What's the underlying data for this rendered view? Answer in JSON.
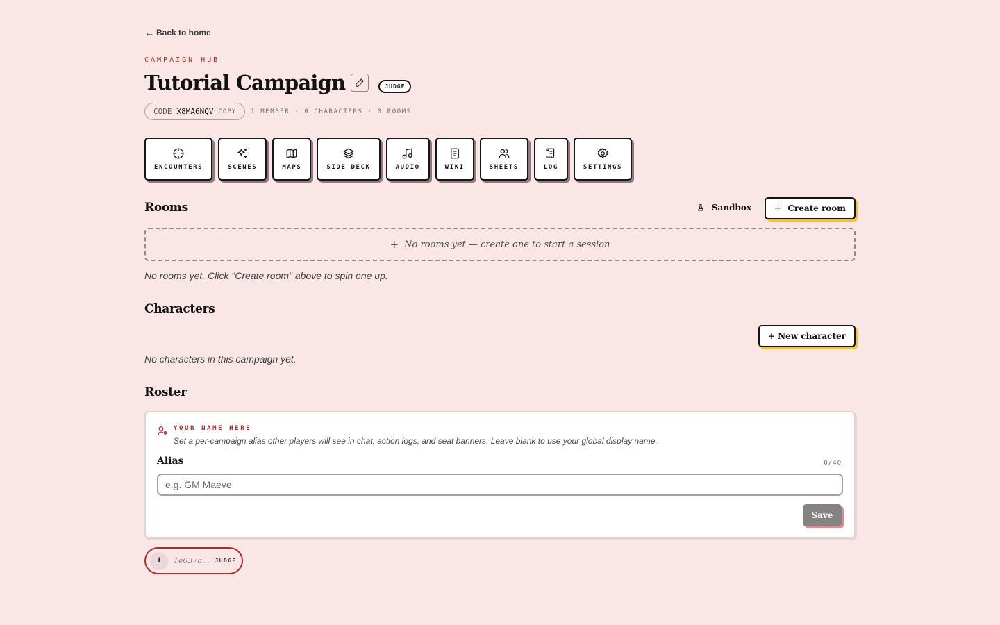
{
  "nav": {
    "back_arrow": "←",
    "back_label": "Back to home"
  },
  "header": {
    "eyebrow": "CAMPAIGN HUB",
    "title": "Tutorial Campaign",
    "role_badge": "JUDGE",
    "code_label": "CODE",
    "code_value": "X8MA6NQV",
    "copy_label": "COPY",
    "stats": "1 MEMBER · 0 CHARACTERS · 0 ROOMS"
  },
  "tools": [
    {
      "label": "ENCOUNTERS",
      "icon": "crosshair-icon"
    },
    {
      "label": "SCENES",
      "icon": "sparkles-icon"
    },
    {
      "label": "MAPS",
      "icon": "map-icon"
    },
    {
      "label": "SIDE DECK",
      "icon": "layers-icon"
    },
    {
      "label": "AUDIO",
      "icon": "music-icon"
    },
    {
      "label": "WIKI",
      "icon": "book-icon"
    },
    {
      "label": "SHEETS",
      "icon": "users-icon"
    },
    {
      "label": "LOG",
      "icon": "scroll-icon"
    },
    {
      "label": "SETTINGS",
      "icon": "gear-icon"
    }
  ],
  "rooms": {
    "title": "Rooms",
    "sandbox_label": "Sandbox",
    "create_icon": "+",
    "create_label": "Create room",
    "empty_icon": "+",
    "empty_label": "No rooms yet — create one to start a session",
    "note": "No rooms yet. Click \"Create room\" above to spin one up."
  },
  "characters": {
    "title": "Characters",
    "new_label": "+ New character",
    "note": "No characters in this campaign yet."
  },
  "roster": {
    "title": "Roster",
    "alias_card": {
      "eyebrow": "YOUR NAME HERE",
      "description": "Set a per-campaign alias other players will see in chat, action logs, and seat banners. Leave blank to use your global display name.",
      "field_label": "Alias",
      "count": "0/40",
      "value": "",
      "placeholder": "e.g. GM Maeve",
      "save_label": "Save"
    },
    "members": [
      {
        "avatar": "1",
        "id": "1e037a...",
        "role": "JUDGE"
      }
    ]
  },
  "colors": {
    "background": "#fbe6e6",
    "accent_red": "#b02a2a",
    "accent_yellow": "#f0c242",
    "ink": "#161616"
  }
}
